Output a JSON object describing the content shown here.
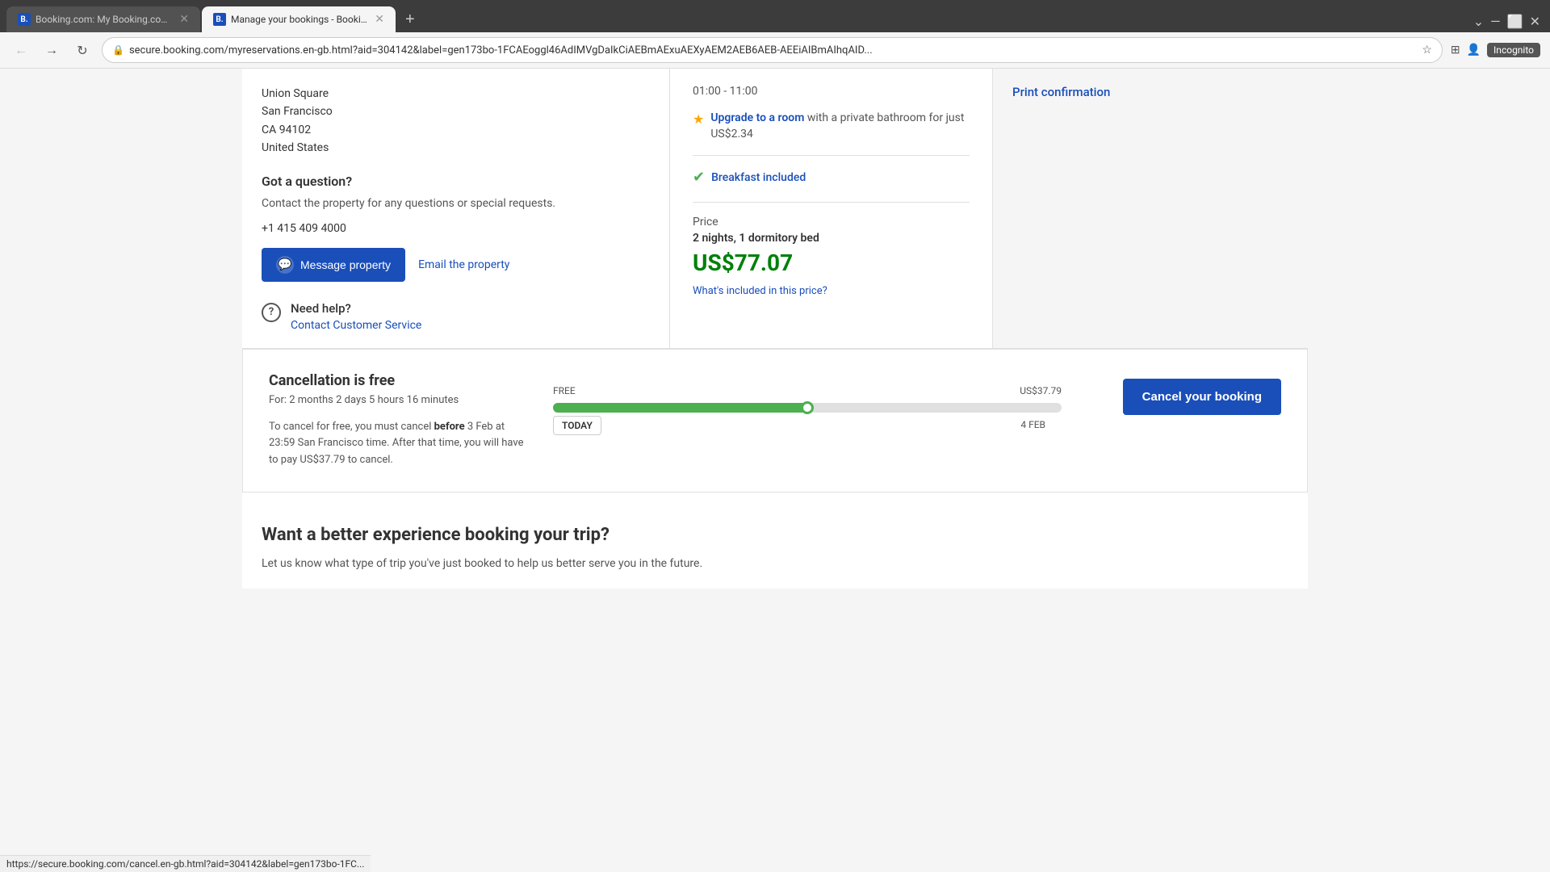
{
  "browser": {
    "tabs": [
      {
        "id": "tab1",
        "favicon": "B",
        "title": "Booking.com: My Booking.com...",
        "active": false,
        "url": ""
      },
      {
        "id": "tab2",
        "favicon": "B",
        "title": "Manage your bookings - Bookin...",
        "active": true,
        "url": "secure.booking.com/myreservations.en-gb.html?aid=304142&label=gen173bo-1FCAEoggl46AdIMVgDaIkCiAEBmAExuAEXyAEM2AEB6AEB-AEEiAIBmAIhqAID..."
      }
    ],
    "new_tab_label": "+",
    "tab_bar_right": {
      "minimize": "—",
      "maximize": "⬜",
      "close": "✕"
    },
    "incognito": "Incognito",
    "status_bar_url": "https://secure.booking.com/cancel.en-gb.html?aid=304142&label=gen173bo-1FC..."
  },
  "left_panel": {
    "address": {
      "line1": "Union Square",
      "line2": "San Francisco",
      "line3": "CA 94102",
      "line4": "United States"
    },
    "question_section": {
      "title": "Got a question?",
      "description": "Contact the property for any questions or special requests.",
      "phone": "+1 415 409 4000",
      "btn_message": "Message property",
      "btn_email": "Email the property"
    },
    "need_help": {
      "title": "Need help?",
      "link": "Contact Customer Service"
    }
  },
  "center_panel": {
    "time_range": "01:00 - 11:00",
    "upgrade": {
      "link_text": "Upgrade to a room",
      "suffix": " with a private bathroom for just US$2.34"
    },
    "breakfast": {
      "text": "Breakfast included"
    },
    "price": {
      "label": "Price",
      "nights_text": "2 nights, 1 dormitory bed",
      "amount": "US$77.07",
      "whats_included": "What's included in this price?"
    }
  },
  "right_panel": {
    "print_confirmation": "Print confirmation"
  },
  "cancellation": {
    "title": "Cancellation is free",
    "subtitle": "For: 2 months 2 days 5 hours 16 minutes",
    "description_pre": "To cancel for free, you must cancel ",
    "description_bold": "before",
    "description_post": " 3 Feb at 23:59 San Francisco time. After that time, you will have to pay US$37.79 to cancel.",
    "timeline": {
      "free_label": "FREE",
      "charge_label": "US$37.79",
      "today_label": "TODAY",
      "date_label": "4 FEB"
    },
    "cancel_button": "Cancel your booking"
  },
  "better_experience": {
    "title": "Want a better experience booking your trip?",
    "description": "Let us know what type of trip you've just booked to help us better serve you in the future."
  },
  "colors": {
    "brand_blue": "#1a4fba",
    "green": "#008009",
    "timeline_green": "#4caf50",
    "orange": "#ffa500"
  }
}
